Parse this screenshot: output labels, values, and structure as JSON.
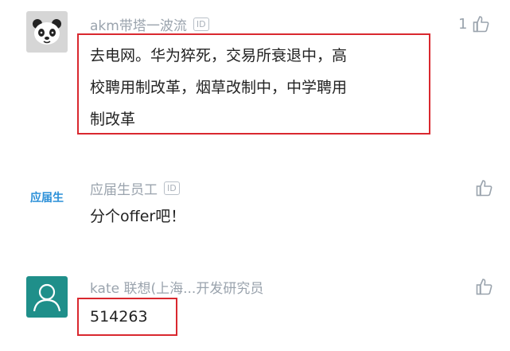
{
  "comments": [
    {
      "username": "akm带塔一波流",
      "badge": "ID",
      "content_lines": [
        "去电网。华为猝死，交易所衰退中，高",
        "校聘用制改革，烟草改制中，中学聘用",
        "制改革"
      ],
      "likes": "1",
      "avatar": "panda-avatar"
    },
    {
      "username": "应届生员工",
      "badge": "ID",
      "content_lines": [
        "分个offer吧！"
      ],
      "likes": "",
      "avatar": "应届生",
      "avatar_text": "应届生"
    },
    {
      "username": "kate 联想(上海...开发研究员",
      "badge": "",
      "content_lines": [
        "514263"
      ],
      "likes": "",
      "avatar": "user-silhouette-avatar"
    }
  ],
  "colors": {
    "highlight": "#d9282f",
    "meta": "#9aa3ad",
    "text": "#222222",
    "teal": "#1f8f8a",
    "brand_blue": "#2a8fd8"
  }
}
